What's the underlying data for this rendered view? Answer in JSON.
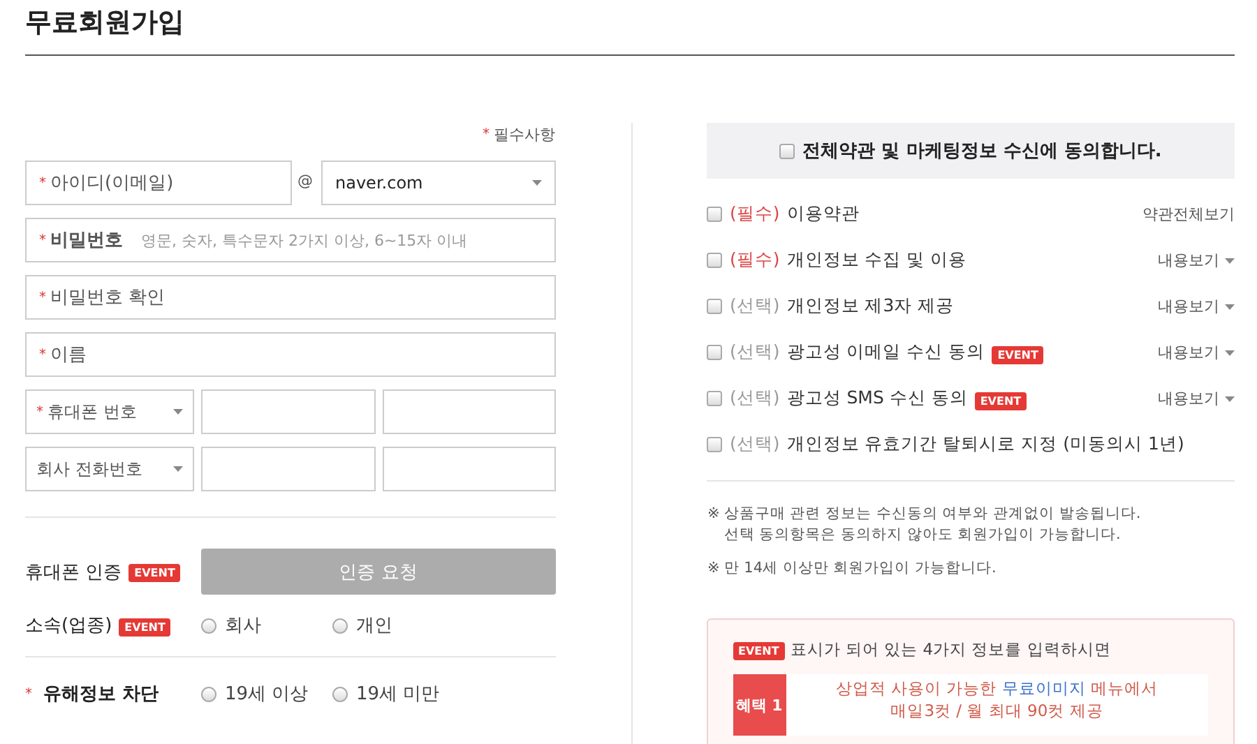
{
  "title": "무료회원가입",
  "required_mark": "*",
  "required_note": "필수사항",
  "email": {
    "label": "아이디(이메일)",
    "required": true,
    "at": "@",
    "domain": "naver.com"
  },
  "fields": [
    {
      "label": "비밀번호",
      "required": true,
      "hint": "영문, 숫자, 특수문자 2가지 이상, 6~15자 이내"
    },
    {
      "label": "비밀번호 확인",
      "required": true
    },
    {
      "label": "이름",
      "required": true
    }
  ],
  "phones": [
    {
      "label": "휴대폰 번호",
      "required": true
    },
    {
      "label": "회사 전화번호",
      "required": false
    }
  ],
  "verify": {
    "label": "휴대폰 인증",
    "badge": "EVENT",
    "button": "인증 요청",
    "disabled": true
  },
  "radio_groups": [
    {
      "label": "소속(업종)",
      "required": false,
      "badge": "EVENT",
      "options": [
        {
          "label": "회사",
          "selected": false
        },
        {
          "label": "개인",
          "selected": false
        }
      ]
    },
    {
      "label": "유해정보 차단",
      "required": true,
      "options": [
        {
          "label": "19세 이상",
          "selected": false
        },
        {
          "label": "19세 미만",
          "selected": false
        }
      ]
    }
  ],
  "agree_all": {
    "label": "전체약관 및 마케팅정보 수신에 동의합니다.",
    "checked": false
  },
  "terms": [
    {
      "tag": "(필수)",
      "kind": "required",
      "label": "이용약관",
      "link": "약관전체보기",
      "caret": false,
      "checked": false
    },
    {
      "tag": "(필수)",
      "kind": "required",
      "label": "개인정보 수집 및 이용",
      "link": "내용보기",
      "caret": true,
      "checked": false
    },
    {
      "tag": "(선택)",
      "kind": "optional",
      "label": "개인정보 제3자 제공",
      "link": "내용보기",
      "caret": true,
      "checked": false
    },
    {
      "tag": "(선택)",
      "kind": "optional",
      "label": "광고성 이메일 수신 동의",
      "badge": "EVENT",
      "link": "내용보기",
      "caret": true,
      "checked": false
    },
    {
      "tag": "(선택)",
      "kind": "optional",
      "label": "광고성 SMS 수신 동의",
      "badge": "EVENT",
      "link": "내용보기",
      "caret": true,
      "checked": false
    },
    {
      "tag": "(선택)",
      "kind": "optional",
      "label": "개인정보 유효기간 탈퇴시로 지정 (미동의시 1년)",
      "checked": false
    }
  ],
  "notes": [
    {
      "mark": "※",
      "lines": [
        "상품구매 관련 정보는 수신동의 여부와 관계없이 발송됩니다.",
        "선택 동의항목은 동의하지 않아도 회원가입이 가능합니다."
      ]
    },
    {
      "mark": "※",
      "lines": [
        "만 14세 이상만 회원가입이 가능합니다."
      ]
    }
  ],
  "event_box": {
    "badge": "EVENT",
    "text": "표시가 되어 있는 4가지 정보를 입력하시면",
    "benefits": [
      {
        "label": "혜택 1",
        "lines": [
          [
            {
              "kind": "text",
              "text": "상업적 사용이 가능한 "
            },
            {
              "kind": "link",
              "text": "무료이미지"
            },
            {
              "kind": "text",
              "text": " 메뉴에서"
            }
          ],
          [
            {
              "kind": "text",
              "text": "매일3컷 / 월 최대 90컷 제공"
            }
          ]
        ]
      }
    ]
  }
}
